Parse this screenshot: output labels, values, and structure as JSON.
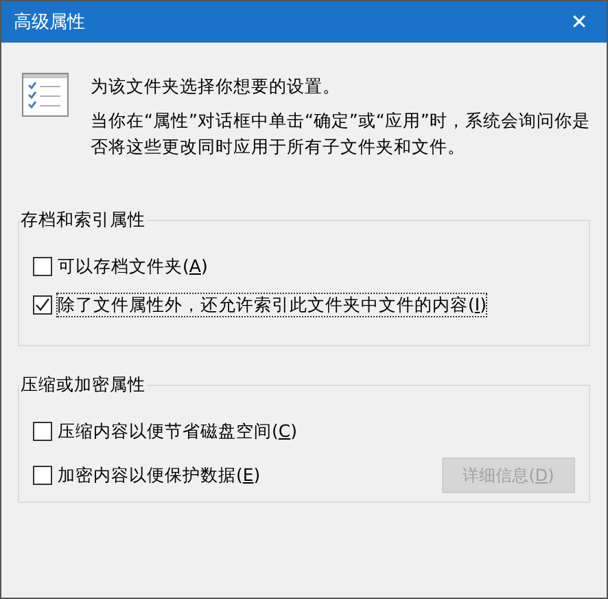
{
  "window": {
    "title": "高级属性",
    "close": "✕"
  },
  "intro": [
    "为该文件夹选择你想要的设置。",
    "当你在“属性”对话框中单击“确定”或“应用”时，系统会询问你是否将这些更改同时应用于所有子文件夹和文件。"
  ],
  "groups": [
    {
      "title": "存档和索引属性",
      "options": [
        {
          "prefix": "可以存档文件夹(",
          "key": "A",
          "suffix": ")",
          "checked": false,
          "focused": false
        },
        {
          "prefix": "除了文件属性外，还允许索引此文件夹中文件的内容(",
          "key": "I",
          "suffix": ")",
          "checked": true,
          "focused": true
        }
      ]
    },
    {
      "title": "压缩或加密属性",
      "options": [
        {
          "prefix": "压缩内容以便节省磁盘空间(",
          "key": "C",
          "suffix": ")",
          "checked": false,
          "focused": false
        },
        {
          "prefix": "加密内容以便保护数据(",
          "key": "E",
          "suffix": ")",
          "checked": false,
          "focused": false
        }
      ],
      "button": {
        "prefix": "详细信息(",
        "key": "D",
        "suffix": ")",
        "disabled": true
      }
    }
  ]
}
